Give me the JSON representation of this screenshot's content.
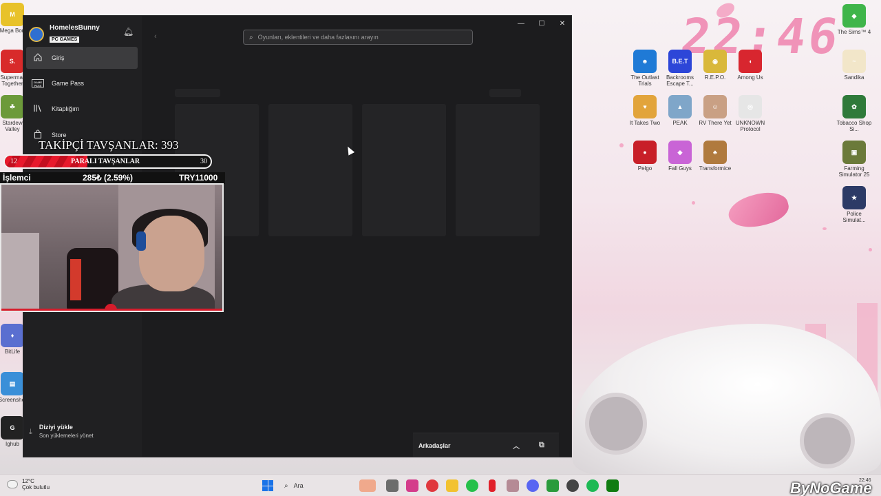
{
  "desktop": {
    "clock": "22:46",
    "icons": [
      {
        "label": "The Outlast Trials",
        "color": "#1f7ad6",
        "glyph": "☻"
      },
      {
        "label": "Backrooms Escape T...",
        "color": "#2d46d8",
        "glyph": "B.E.T"
      },
      {
        "label": "R.E.P.O.",
        "color": "#d9b83a",
        "glyph": "◉"
      },
      {
        "label": "Among Us",
        "color": "#d8262f",
        "glyph": "◖"
      },
      {
        "label": "It Takes Two",
        "color": "#e2a43b",
        "glyph": "♥"
      },
      {
        "label": "PEAK",
        "color": "#7fa6c9",
        "glyph": "▲"
      },
      {
        "label": "RV There Yet",
        "color": "#c9a084",
        "glyph": "☺"
      },
      {
        "label": "UNKNOWN Protocol",
        "color": "#e6e6e6",
        "glyph": "◎"
      },
      {
        "label": "Pelgo",
        "color": "#c81f28",
        "glyph": "●"
      },
      {
        "label": "Fall Guys",
        "color": "#c964d6",
        "glyph": "◆"
      },
      {
        "label": "Transformice",
        "color": "#b07a3e",
        "glyph": "♣"
      }
    ],
    "right_icons": [
      {
        "label": "The Sims™ 4",
        "color": "#3fb54a",
        "glyph": "◆"
      },
      {
        "label": "Sandika",
        "color": "#f2e6c9",
        "glyph": "~"
      },
      {
        "label": "Tobacco Shop Si...",
        "color": "#2f7a3a",
        "glyph": "✿"
      },
      {
        "label": "Farming Simulator 25",
        "color": "#6b7a3a",
        "glyph": "▣"
      },
      {
        "label": "Police Simulat...",
        "color": "#2c3a66",
        "glyph": "★"
      }
    ],
    "left_icons": [
      {
        "label": "Mega Bon",
        "color": "#e8c22a",
        "glyph": "M"
      },
      {
        "label": "Supermar Together",
        "color": "#d82a2a",
        "glyph": "S."
      },
      {
        "label": "Stardew Valley",
        "color": "#6c9a3a",
        "glyph": "☘"
      },
      {
        "label": "BitLife",
        "color": "#5a6fd0",
        "glyph": "♦"
      },
      {
        "label": "Screenshot",
        "color": "#3a8fd8",
        "glyph": "▤"
      },
      {
        "label": "Ighub",
        "color": "#222222",
        "glyph": "G"
      }
    ]
  },
  "xbox": {
    "profile_name": "HomelesBunny",
    "profile_badge": "PC GAMES",
    "nav": [
      {
        "label": "Giriş",
        "icon": "home-icon"
      },
      {
        "label": "Game Pass",
        "icon": "game-pass-icon"
      },
      {
        "label": "Kitaplığım",
        "icon": "library-icon"
      },
      {
        "label": "Store",
        "icon": "store-icon"
      }
    ],
    "gp_icon_text": "GAME PASS",
    "search_placeholder": "Oyunları, eklentileri ve daha fazlasını arayın",
    "install_title": "Diziyi yükle",
    "install_sub": "Son yüklemeleri yönet",
    "friends_label": "Arkadaşlar"
  },
  "overlay": {
    "follow_text": "TAKİPÇİ TAVŞANLAR: 393",
    "goal_current": "12",
    "goal_label": "PARALI TAVŞANLAR",
    "goal_target": "30",
    "goal_progress": 0.4,
    "stock_name": "İşlemci",
    "stock_change": "285₺ (2.59%)",
    "stock_price": "TRY11000"
  },
  "taskbar": {
    "temp": "12°C",
    "weather": "Çok bulutlu",
    "search_label": "Ara",
    "brand": "ByNoGame",
    "time": "22:46"
  }
}
